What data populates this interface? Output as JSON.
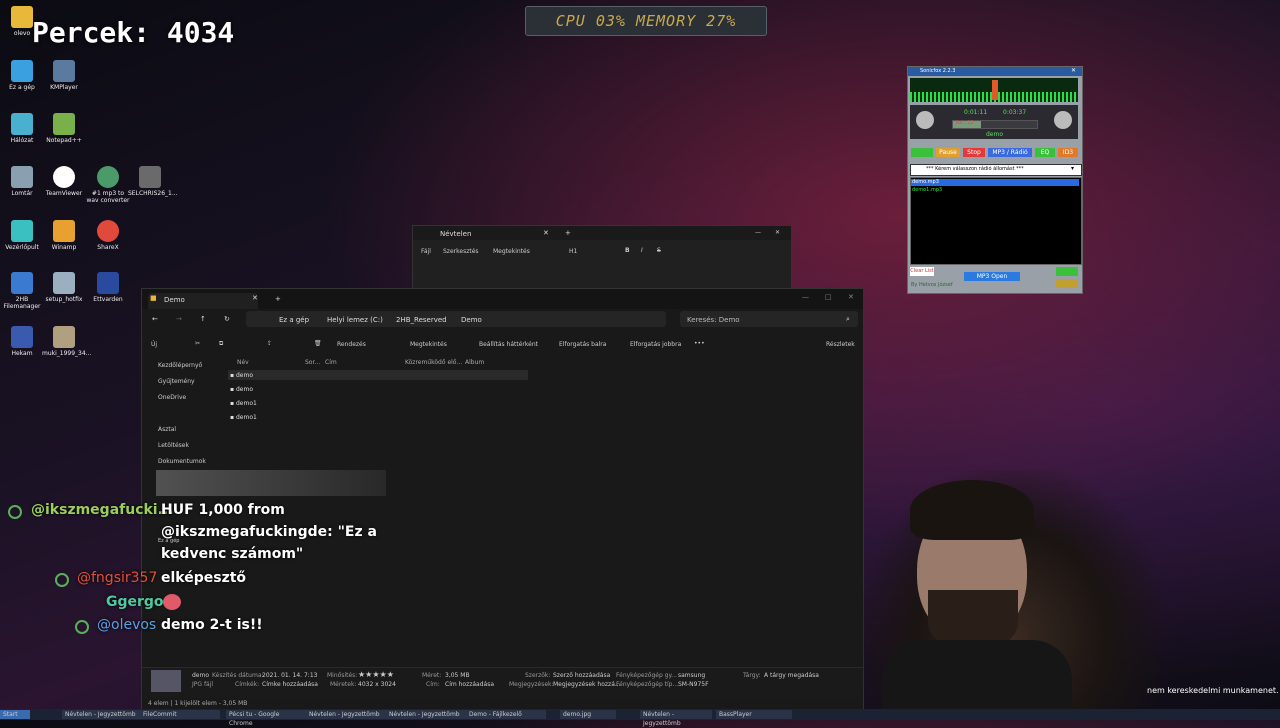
{
  "overlay": {
    "timer": "Percek: 4034",
    "cpu_meter": "CPU 03% MEMORY 27%"
  },
  "desktop_icons": [
    {
      "label": "olevo"
    },
    {
      "label": "Ez a gép"
    },
    {
      "label": "KMPlayer"
    },
    {
      "label": "Hálózat"
    },
    {
      "label": "Notepad++"
    },
    {
      "label": "Lomtár"
    },
    {
      "label": "TeamViewer"
    },
    {
      "label": "#1 mp3 to wav converter"
    },
    {
      "label": "SELCHRIS26_1..."
    },
    {
      "label": "Vezérlőpult"
    },
    {
      "label": "Winamp"
    },
    {
      "label": "ShareX"
    },
    {
      "label": "2HB Filemanager"
    },
    {
      "label": "setup_hotfix"
    },
    {
      "label": "Ettvarden"
    },
    {
      "label": "Hekam"
    },
    {
      "label": "muki_1999_34..."
    }
  ],
  "notepad": {
    "tab_title": "Névtelen",
    "menu": [
      "Fájl",
      "Szerkesztés",
      "Megtekintés"
    ],
    "heading_label": "H1"
  },
  "explorer": {
    "tab_title": "Demo",
    "breadcrumb": [
      "Ez a gép",
      "Helyi lemez (C:)",
      "2HB_Reserved",
      "Demo"
    ],
    "search_placeholder": "Keresés: Demo",
    "toolbar": {
      "new": "Új",
      "sort": "Rendezés",
      "view": "Megtekintés",
      "set_background": "Beállítás háttérként",
      "rotate_left": "Elforgatás balra",
      "rotate_right": "Elforgatás jobbra",
      "details": "Részletek"
    },
    "columns": [
      "Név",
      "Sor...",
      "Cím",
      "Közreműködő elő...",
      "Album"
    ],
    "files": [
      "demo",
      "demo",
      "demo1",
      "demo1"
    ],
    "nav": [
      "Kezdőlépernyő",
      "Gyűjtemény",
      "OneDrive",
      "Asztal",
      "Letöltések",
      "Dokumentumok",
      "Ez a gép"
    ],
    "details_pane": {
      "name": "demo",
      "type": "JPG fájl",
      "date_label": "Készítés dátuma:",
      "date_value": "2021. 01. 14. 7:13",
      "tags_label": "Címkék:",
      "tags_value": "Címke hozzáadása",
      "rating_label": "Minősítés:",
      "rating_value": "★★★★★",
      "dimensions_label": "Méretek:",
      "dimensions_value": "4032 x 3024",
      "size_label": "Méret:",
      "size_value": "3,05 MB",
      "title_label": "Cím:",
      "title_value": "Cím hozzáadása",
      "authors_label": "Szerzők:",
      "authors_value": "Szerző hozzáadása",
      "comments_label": "Megjegyzések:",
      "comments_value": "Megjegyzések hozzá...",
      "camera_maker_label": "Fényképezőgép gy...",
      "camera_maker_value": "samsung",
      "camera_model_label": "Fényképezőgép típ...",
      "camera_model_value": "SM-N975F",
      "subject_label": "Tárgy:",
      "subject_value": "A tárgy megadása"
    },
    "status": "4 elem  |  1 kijelölt elem - 3,05 MB"
  },
  "player": {
    "title": "Sonicfox 2.2.3",
    "time_elapsed": "0:01:11",
    "time_total": "0:03:37",
    "vol_label": "Vol.: 12",
    "track": "demo",
    "buttons": [
      "Play",
      "Pause",
      "Stop",
      "MP3 / Rádió",
      "EQ",
      "ID3"
    ],
    "radio_select": "*** Kérem válasszon rádió állomást ***",
    "playlist": [
      "demo.mp3",
      "demo1.mp3"
    ],
    "clear_list": "Clear List",
    "mp3_open": "MP3 Open",
    "author": "By Hetvos József"
  },
  "chat": [
    {
      "user": "@ikszmegafucki...",
      "message": "HUF 1,000 from @ikszmegafuckingde: \"Ez a kedvenc számom\"",
      "user_color": "#9acd5a"
    },
    {
      "user": "@fngsir357",
      "message": "elképesztő",
      "user_color": "#e0503a"
    },
    {
      "user": "Ggergo",
      "message": "",
      "user_color": "#4fc9a0"
    },
    {
      "user": "@olevos",
      "message": "demo 2-t is!!",
      "user_color": "#5aa0e0"
    }
  ],
  "chat_lines": {
    "donation_1": "HUF 1,000 from",
    "donation_2": "@ikszmegafuckingde: \"Ez a",
    "donation_3": "kedvenc számom\""
  },
  "watermark": "nem kereskedelmi munkamenet.",
  "taskbar": {
    "start": "Start",
    "items": [
      "Névtelen - Jegyzettömb",
      "FileCommit",
      "Pécsi tu - Google Chrome",
      "Névtelen - Jegyzettömb",
      "Névtelen - Jegyzettömb",
      "Demo - Fájlkezelő",
      "demo.jpg",
      "Névtelen - Jegyzettömb",
      "BassPlayer"
    ]
  }
}
